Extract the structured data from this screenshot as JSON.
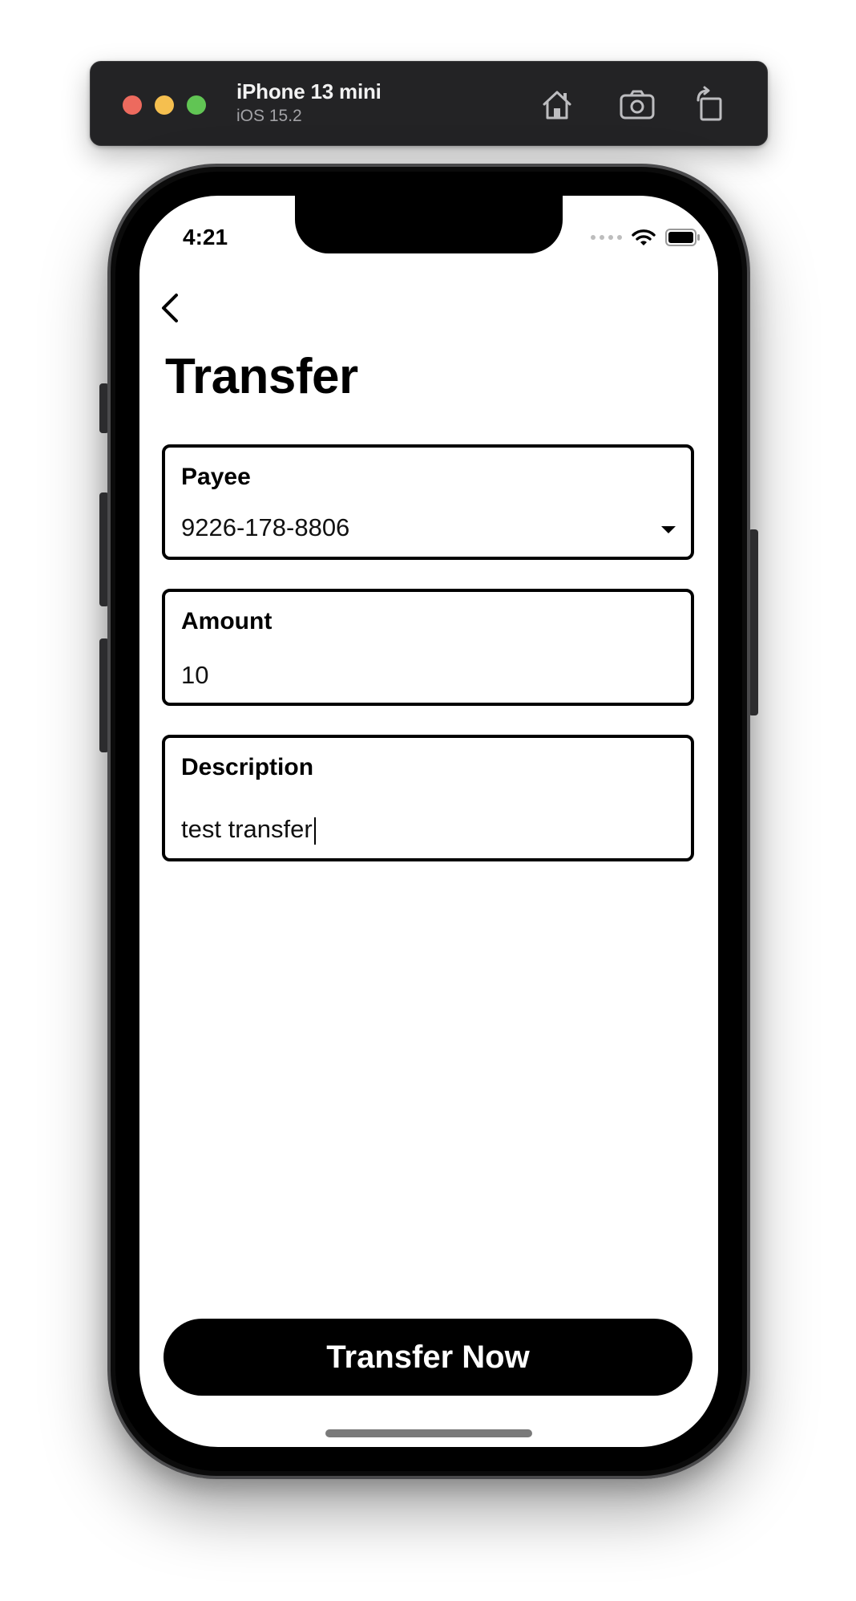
{
  "simulator": {
    "device_name": "iPhone 13 mini",
    "os_version": "iOS 15.2",
    "icons": [
      "home-icon",
      "screenshot-icon",
      "rotate-icon"
    ]
  },
  "status_bar": {
    "time": "4:21",
    "icons": [
      "signal-dots-icon",
      "wifi-icon",
      "battery-icon"
    ]
  },
  "nav": {
    "back_icon": "chevron-left-icon"
  },
  "page": {
    "title": "Transfer"
  },
  "form": {
    "payee": {
      "label": "Payee",
      "value": "9226-178-8806",
      "icon": "dropdown-arrow-icon"
    },
    "amount": {
      "label": "Amount",
      "value": "10"
    },
    "description": {
      "label": "Description",
      "value": "test transfer"
    }
  },
  "actions": {
    "primary_label": "Transfer Now"
  },
  "colors": {
    "primary": "#000000",
    "background": "#ffffff",
    "simulator_bar": "#232325"
  }
}
